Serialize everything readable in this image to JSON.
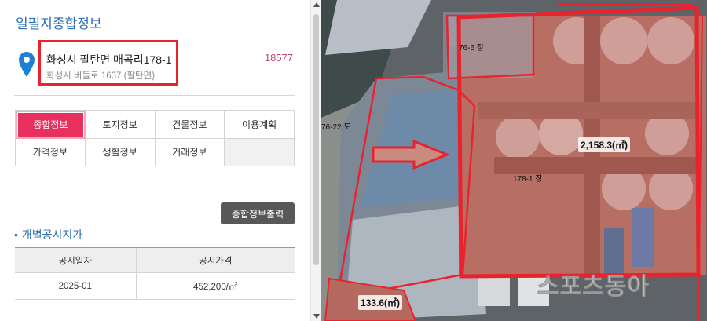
{
  "panel": {
    "title": "일필지종합정보",
    "address_main": "화성시 팔탄면 매곡리178-1",
    "address_road": "화성시 버들로 1637 (팔탄면)",
    "parcel_code": "18577"
  },
  "tabs": [
    {
      "label": "종합정보",
      "active": true
    },
    {
      "label": "토지정보",
      "active": false
    },
    {
      "label": "건물정보",
      "active": false
    },
    {
      "label": "이용계획",
      "active": false
    },
    {
      "label": "가격정보",
      "active": false
    },
    {
      "label": "생활정보",
      "active": false
    },
    {
      "label": "거래정보",
      "active": false
    }
  ],
  "print_button": "종합정보출력",
  "price_section": {
    "bullet": "•",
    "title": "개별공시지가",
    "headers": [
      "공시일자",
      "공시가격"
    ],
    "rows": [
      [
        "2025-01",
        "452,200/㎡"
      ]
    ]
  },
  "map": {
    "labels": [
      "76-6 장",
      "76-22 도",
      "178-1 장"
    ],
    "areas": [
      "2,158.3(㎡)",
      "133.6(㎡)"
    ],
    "watermark": "스포츠동아"
  },
  "colors": {
    "accent": "#2c6fb8",
    "active_tab": "#e8305e",
    "highlight": "#e8232e"
  },
  "icons": [
    "location-pin-icon"
  ]
}
